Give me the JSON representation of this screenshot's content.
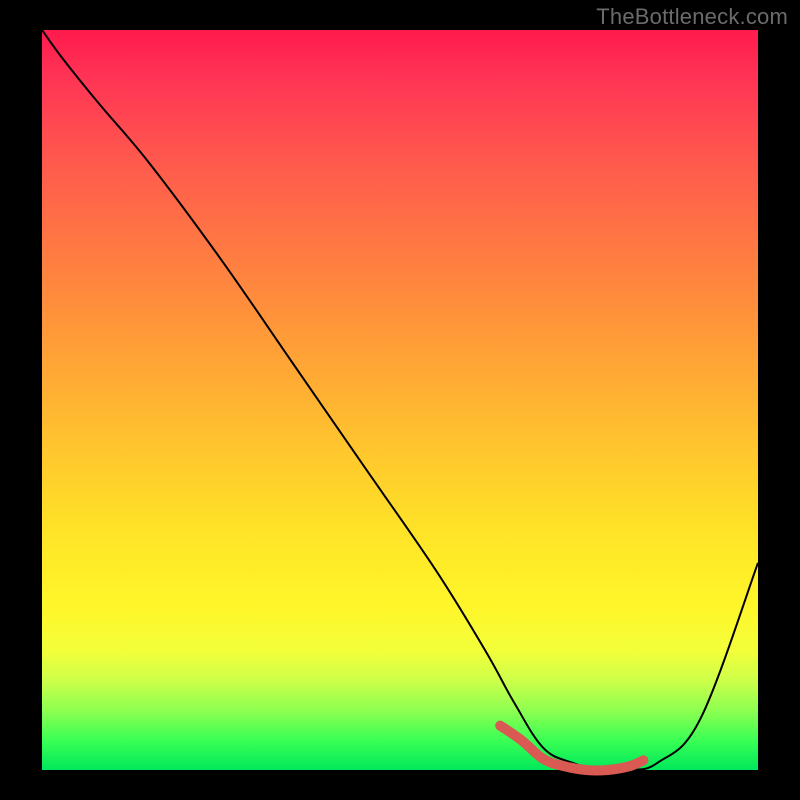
{
  "watermark": "TheBottleneck.com",
  "chart_data": {
    "type": "line",
    "title": "",
    "xlabel": "",
    "ylabel": "",
    "xlim": [
      0,
      100
    ],
    "ylim": [
      0,
      100
    ],
    "series": [
      {
        "name": "bottleneck-curve",
        "x": [
          0,
          3,
          8,
          15,
          25,
          35,
          45,
          55,
          62,
          66,
          70,
          74,
          78,
          82,
          86,
          92,
          100
        ],
        "values": [
          100,
          96,
          90,
          82,
          69,
          55,
          41,
          27,
          16,
          9,
          3,
          1,
          0,
          0,
          1,
          7,
          28
        ]
      }
    ],
    "highlight": {
      "name": "optimal-range",
      "x": [
        64,
        67,
        70,
        73,
        76,
        79,
        82,
        84
      ],
      "values": [
        6,
        4,
        1.5,
        0.5,
        0,
        0,
        0.5,
        1.3
      ],
      "color": "#d85a52"
    }
  }
}
